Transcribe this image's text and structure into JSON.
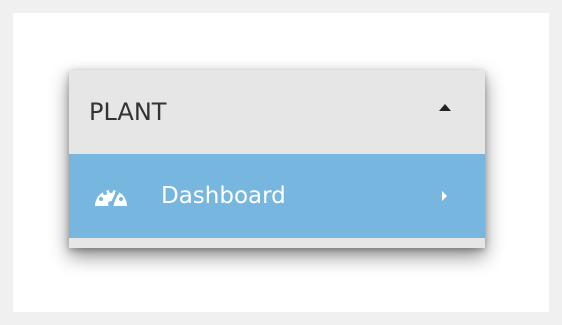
{
  "panel": {
    "title": "PLANT",
    "collapse_icon": "caret-up-icon"
  },
  "menu": {
    "items": [
      {
        "label": "Dashboard",
        "icon": "dashboard-gauge-icon",
        "expand_icon": "caret-right-icon",
        "active": true
      }
    ]
  },
  "colors": {
    "header_bg": "#e6e6e6",
    "active_item_bg": "#77b6df",
    "active_item_text": "#ffffff",
    "header_text": "#333333",
    "page_bg": "#f0f0f0"
  }
}
